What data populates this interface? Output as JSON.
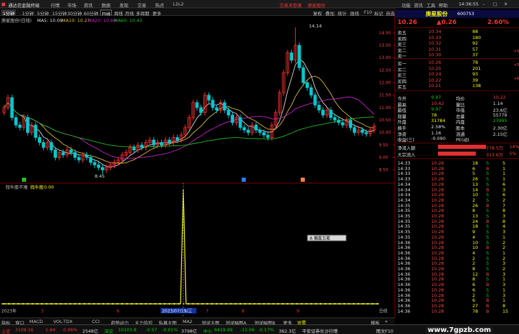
{
  "titlebar": {
    "app_name": "通达信金融终端",
    "menus": [
      "行情",
      "市场",
      "资讯",
      "数据",
      "发现",
      "交易",
      "热点",
      "L1L2"
    ],
    "login_prompt": "交易未登录",
    "stock_link": "庚星股份",
    "right_items": [
      "功能",
      "资讯",
      "工具",
      "帮助"
    ],
    "clock": "14:36:55"
  },
  "toolbar": {
    "periods": [
      "1分钟",
      "1分钟",
      "5分钟",
      "15分钟",
      "30分钟",
      "60分钟",
      "日线",
      "周线",
      "月线",
      "多周期",
      "更多"
    ],
    "buttons": [
      "复权",
      "叠加",
      "统计",
      "画线",
      "F10",
      "标记",
      "自选",
      "返回"
    ]
  },
  "chart": {
    "info_title": "庚星股份(日线)",
    "ma5": "MA5: 10.09",
    "ma10": "MA10: 10.27",
    "ma20": "MA20: 10.69",
    "ma60": "MA60: 10.43",
    "y_ticks": [
      "14.00",
      "13.50",
      "13.00",
      "12.50",
      "12.00",
      "11.50",
      "11.00",
      "10.50",
      "10.00",
      "9.50",
      "9.00",
      "8.50"
    ],
    "high_label": "14.14",
    "low_label": "8.45",
    "indicator_label": "找牛股不难",
    "indicator_name": "找牛股",
    "indicator_value": "0.00",
    "indicator_badge": "A 偶直五笔",
    "date_label": "2023/07/19/三",
    "year_label": "2023年",
    "month_labels": [
      "5",
      "6",
      "7",
      "8",
      "9"
    ],
    "x_extra": "日线",
    "colors": {
      "up": "#ff3030",
      "down": "#00c8d0",
      "ma5": "#e0e0e0",
      "ma10": "#e0c040",
      "ma20": "#d020d0",
      "ma60": "#20c020",
      "signal": "#ffff20"
    }
  },
  "bottom_tabs": {
    "items": [
      "指标",
      "窗口",
      "MACD",
      "VOL-TDX",
      "CCI",
      "趋势动力",
      "主力监控",
      "私募主图",
      "MA2",
      "测试主图",
      "测试幅图A",
      "测试幅图B",
      "更多",
      "设置"
    ],
    "right_items": [
      "模板",
      "+"
    ]
  },
  "quote": {
    "name": "庚星股份",
    "code": "600753",
    "price": "10.26",
    "change": "▲0.26",
    "pct": "2.60%",
    "asks": [
      {
        "label": "卖五",
        "price": "10.34",
        "vol": "88"
      },
      {
        "label": "卖四",
        "price": "10.33",
        "vol": "180"
      },
      {
        "label": "卖三",
        "price": "10.32",
        "vol": "92"
      },
      {
        "label": "卖二",
        "price": "10.31",
        "vol": "57"
      },
      {
        "label": "卖一",
        "price": "10.30",
        "vol": "37"
      }
    ],
    "bids": [
      {
        "label": "买一",
        "price": "10.26",
        "vol": "78"
      },
      {
        "label": "买二",
        "price": "10.25",
        "vol": "201"
      },
      {
        "label": "买三",
        "price": "10.24",
        "vol": "93"
      },
      {
        "label": "买四",
        "price": "10.22",
        "vol": "39"
      },
      {
        "label": "买五",
        "price": "10.21",
        "vol": "138"
      }
    ],
    "stats": [
      {
        "l1": "今开",
        "v1": "9.97",
        "l2": "均价",
        "v2": "10.22"
      },
      {
        "l1": "最高",
        "v1": "10.42",
        "l2": "量比",
        "v2": "1.14"
      },
      {
        "l1": "最低",
        "v1": "9.97",
        "l2": "市值",
        "v2": "23.6亿"
      },
      {
        "l1": "现量",
        "v1": "78",
        "l2": "总量",
        "v2": "55779"
      },
      {
        "l1": "外盘",
        "v1": "31784",
        "l2": "内盘",
        "v2": "23995"
      },
      {
        "l1": "换手",
        "v1": "2.58%",
        "l2": "股本",
        "v2": "2.30亿"
      },
      {
        "l1": "净资",
        "v1": "1.16",
        "l2": "流通",
        "v2": "2.15亿"
      },
      {
        "l1": "收益(三)",
        "v1": "-0.090",
        "l2": "PE(动)",
        "v2": ""
      }
    ],
    "flow": [
      {
        "label": "净流入额",
        "value": "778.5万",
        "pct": "14%"
      },
      {
        "label": "大宗流入",
        "value": "313.6万",
        "pct": "5%"
      }
    ],
    "ticks": [
      {
        "t": "14:33",
        "p": "10.26",
        "v": "18",
        "d": "S",
        "n": "5"
      },
      {
        "t": "14:33",
        "p": "10.28",
        "v": "6",
        "d": "B",
        "n": "1"
      },
      {
        "t": "14:33",
        "p": "10.28",
        "v": "5",
        "d": "S",
        "n": "1"
      },
      {
        "t": "14:33",
        "p": "10.28",
        "v": "26",
        "d": "S",
        "n": "1"
      },
      {
        "t": "14:34",
        "p": "10.28",
        "v": "13",
        "d": "S",
        "n": "6"
      },
      {
        "t": "14:34",
        "p": "10.28",
        "v": "14",
        "d": "B",
        "n": "3"
      },
      {
        "t": "14:34",
        "p": "10.28",
        "v": "10",
        "d": "S",
        "n": "6"
      },
      {
        "t": "14:34",
        "p": "10.28",
        "v": "2",
        "d": "S",
        "n": "2"
      },
      {
        "t": "14:35",
        "p": "10.28",
        "v": "26",
        "d": "B",
        "n": "7"
      },
      {
        "t": "14:35",
        "p": "10.28",
        "v": "8",
        "d": "S",
        "n": "8"
      },
      {
        "t": "14:35",
        "p": "10.28",
        "v": "13",
        "d": "S",
        "n": "3"
      },
      {
        "t": "14:35",
        "p": "10.28",
        "v": "24",
        "d": "B",
        "n": "8"
      },
      {
        "t": "14:35",
        "p": "10.28",
        "v": "18",
        "d": "S",
        "n": "4"
      },
      {
        "t": "14:35",
        "p": "10.28",
        "v": "9",
        "d": "S",
        "n": "3"
      },
      {
        "t": "14:35",
        "p": "10.28",
        "v": "4",
        "d": "S",
        "n": "1"
      },
      {
        "t": "14:36",
        "p": "10.28",
        "v": "10",
        "d": "S",
        "n": "2"
      },
      {
        "t": "14:36",
        "p": "10.28",
        "v": "10",
        "d": "B",
        "n": "2"
      },
      {
        "t": "14:36",
        "p": "10.28",
        "v": "4",
        "d": "S",
        "n": "1"
      },
      {
        "t": "14:36",
        "p": "10.28",
        "v": "2",
        "d": "S",
        "n": "2"
      },
      {
        "t": "14:36",
        "p": "10.28",
        "v": "2",
        "d": "S",
        "n": "3"
      },
      {
        "t": "14:36",
        "p": "10.28",
        "v": "8",
        "d": "S",
        "n": "2"
      },
      {
        "t": "14:36",
        "p": "10.28",
        "v": "12",
        "d": "B",
        "n": "3"
      },
      {
        "t": "14:36",
        "p": "10.28",
        "v": "8",
        "d": "S",
        "n": "1"
      },
      {
        "t": "14:36",
        "p": "10.28",
        "v": "6",
        "d": "B",
        "n": "3"
      },
      {
        "t": "14:36",
        "p": "10.28",
        "v": "6",
        "d": "S",
        "n": "1"
      },
      {
        "t": "14:36",
        "p": "10.28",
        "v": "2",
        "d": "S",
        "n": "3"
      },
      {
        "t": "14:36",
        "p": "10.28",
        "v": "6",
        "d": "B",
        "n": "1"
      },
      {
        "t": "14:36",
        "p": "10.28",
        "v": "27",
        "d": "B",
        "n": "8"
      },
      {
        "t": "14:36",
        "p": "10.28",
        "v": "78",
        "d": "B",
        "n": "15"
      }
    ],
    "side_tabs": [
      "+4",
      "+5",
      "+6"
    ]
  },
  "statusbar": {
    "left_tabs": [
      "扩展A",
      "关联股份",
      "资金分布",
      "综合资讯",
      "行业资讯",
      "互动问答",
      "首页股价数据说明"
    ],
    "sh_label": "上证",
    "sh_val": "3109.16",
    "sh_chg": "1.84",
    "sh_pct": "0.06%",
    "sh_amt": "2548亿",
    "sz_label": "深证",
    "sz_val": "10103.8",
    "sz_chg": "-0.57",
    "sz_pct": "-0.01%",
    "sz_amt": "3798亿",
    "zx_label": "中小",
    "zx_val": "6419.99",
    "zx_chg": "-11.06",
    "zx_pct": "-0.17%",
    "zx_amt": "362.3亿",
    "broker": "平安证券长沙行情",
    "f10": "图文F10"
  },
  "watermark": "www.7gpzb.com"
}
